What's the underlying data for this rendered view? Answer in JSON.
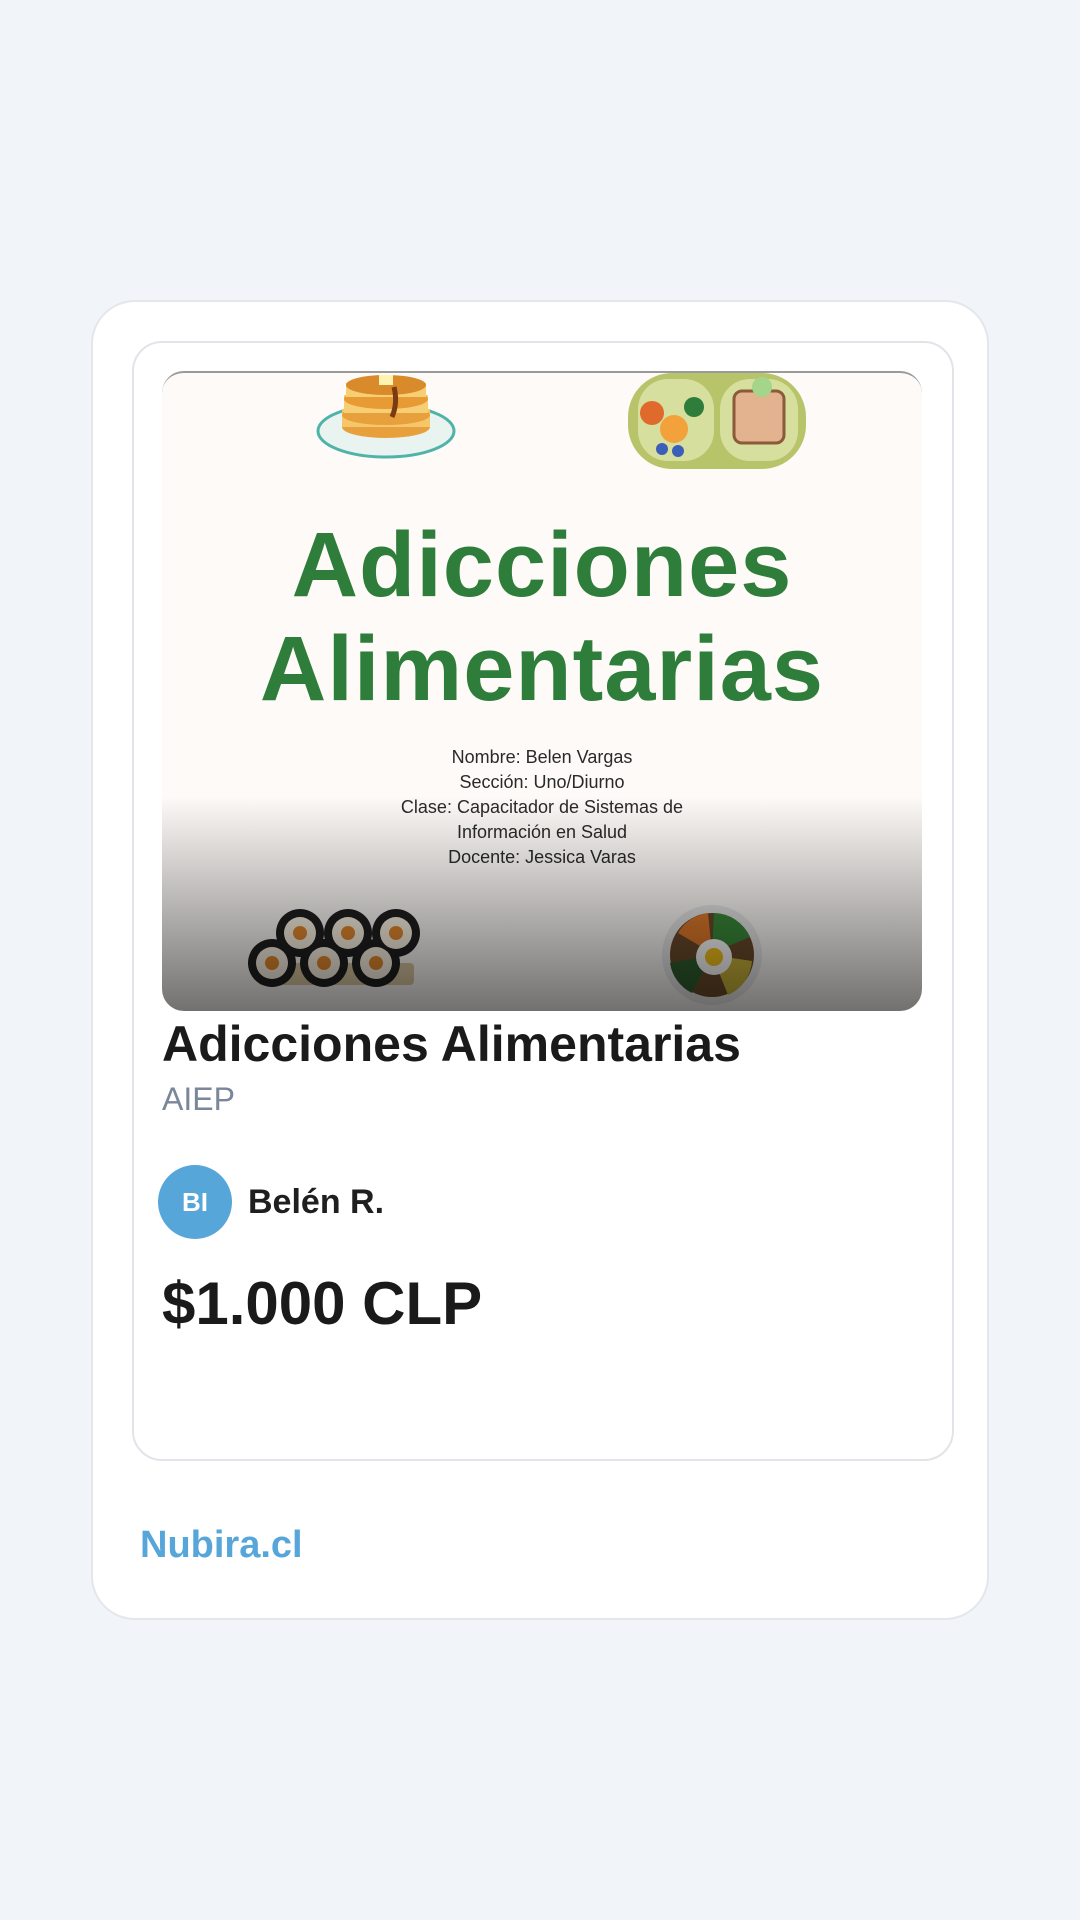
{
  "product": {
    "thumbnail": {
      "title_line1": "Adicciones",
      "title_line2": "Alimentarias",
      "info_lines": [
        "Nombre: Belen Vargas",
        "Sección: Uno/Diurno",
        "Clase: Capacitador de Sistemas de",
        "Información en Salud",
        "Docente: Jessica Varas"
      ],
      "icons": [
        "pancakes-icon",
        "lunchbox-icon",
        "sushi-icon",
        "bibimbap-icon"
      ]
    },
    "title": "Adicciones Alimentarias",
    "institution": "AIEP",
    "seller": {
      "initials": "BI",
      "name": "Belén R."
    },
    "price": "$1.000 CLP"
  },
  "footer": {
    "brand": "Nubira.cl"
  },
  "colors": {
    "background": "#f1f5f9",
    "accent": "#57a6d9",
    "thumbnail_title": "#2e7d3a"
  }
}
